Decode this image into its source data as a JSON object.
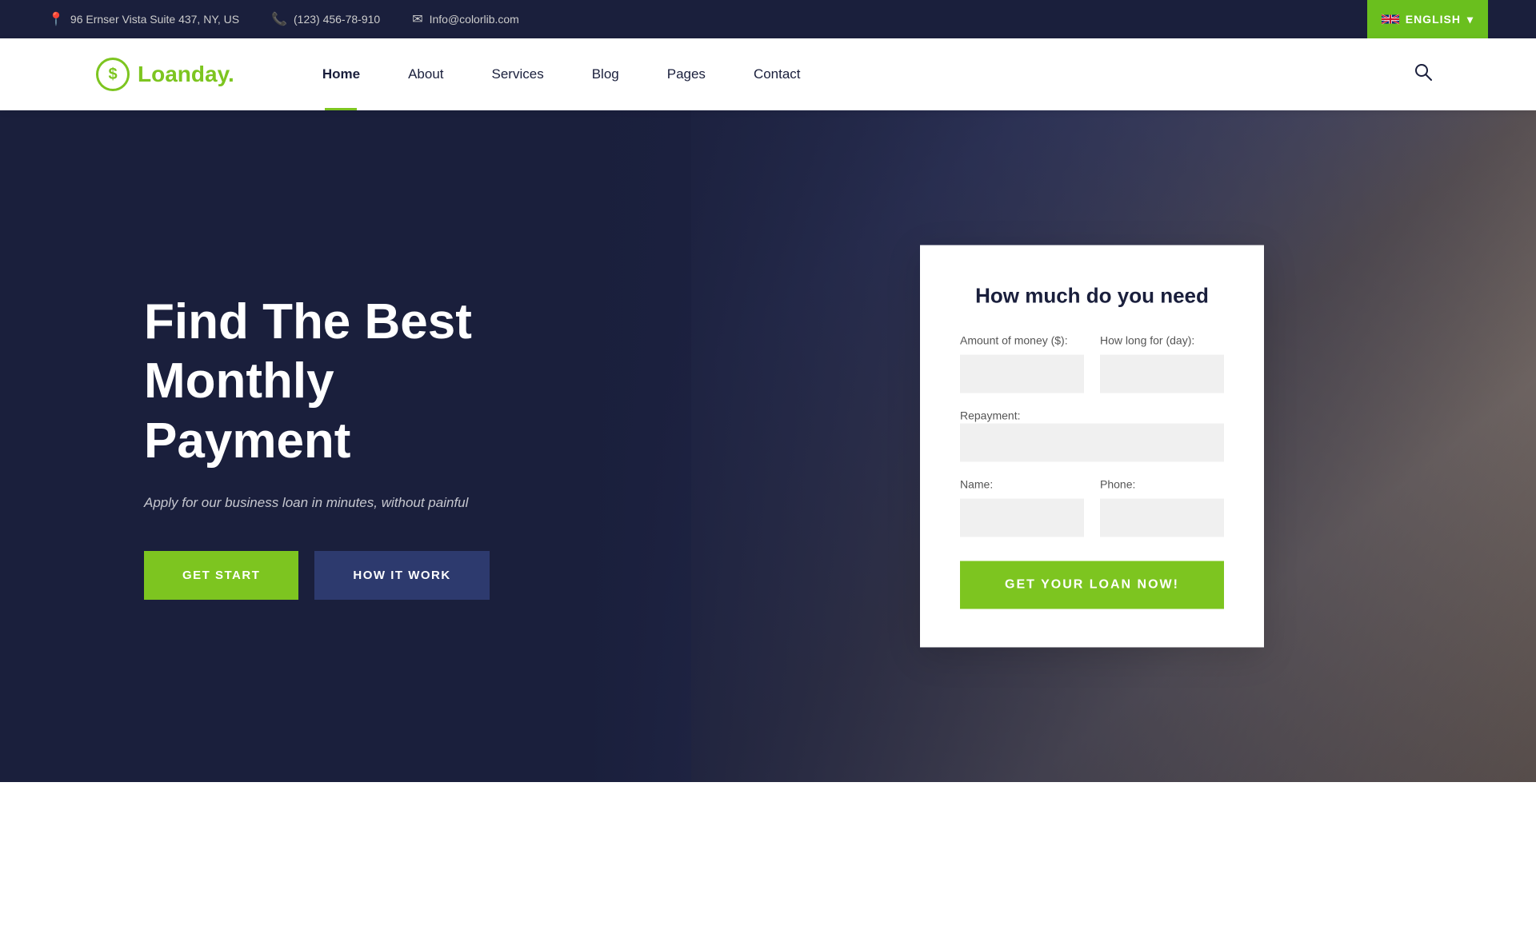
{
  "topbar": {
    "address_icon": "📍",
    "address": "96 Ernser Vista Suite 437, NY, US",
    "phone_icon": "📞",
    "phone": "(123) 456-78-910",
    "email_icon": "✉",
    "email": "Info@colorlib.com",
    "lang_label": "ENGLISH",
    "lang_chevron": "▾"
  },
  "navbar": {
    "logo_icon": "$",
    "logo_name_dark": "Loan",
    "logo_name_green": "day.",
    "nav_items": [
      {
        "label": "Home",
        "active": true
      },
      {
        "label": "About",
        "active": false
      },
      {
        "label": "Services",
        "active": false
      },
      {
        "label": "Blog",
        "active": false
      },
      {
        "label": "Pages",
        "active": false
      },
      {
        "label": "Contact",
        "active": false
      }
    ],
    "search_icon": "🔍"
  },
  "hero": {
    "title_line1": "Find The Best",
    "title_line2": "Monthly Payment",
    "subtitle": "Apply for our business loan in minutes, without painful",
    "btn_primary": "GET START",
    "btn_secondary": "HOW IT WORK"
  },
  "loan_form": {
    "title": "How much do you need",
    "amount_label": "Amount of money ($):",
    "duration_label": "How long for (day):",
    "repayment_label": "Repayment:",
    "name_label": "Name:",
    "phone_label": "Phone:",
    "submit_label": "GET YOUR LOAN NOW!",
    "amount_placeholder": "",
    "duration_placeholder": "",
    "repayment_placeholder": "",
    "name_placeholder": "",
    "phone_placeholder": ""
  }
}
